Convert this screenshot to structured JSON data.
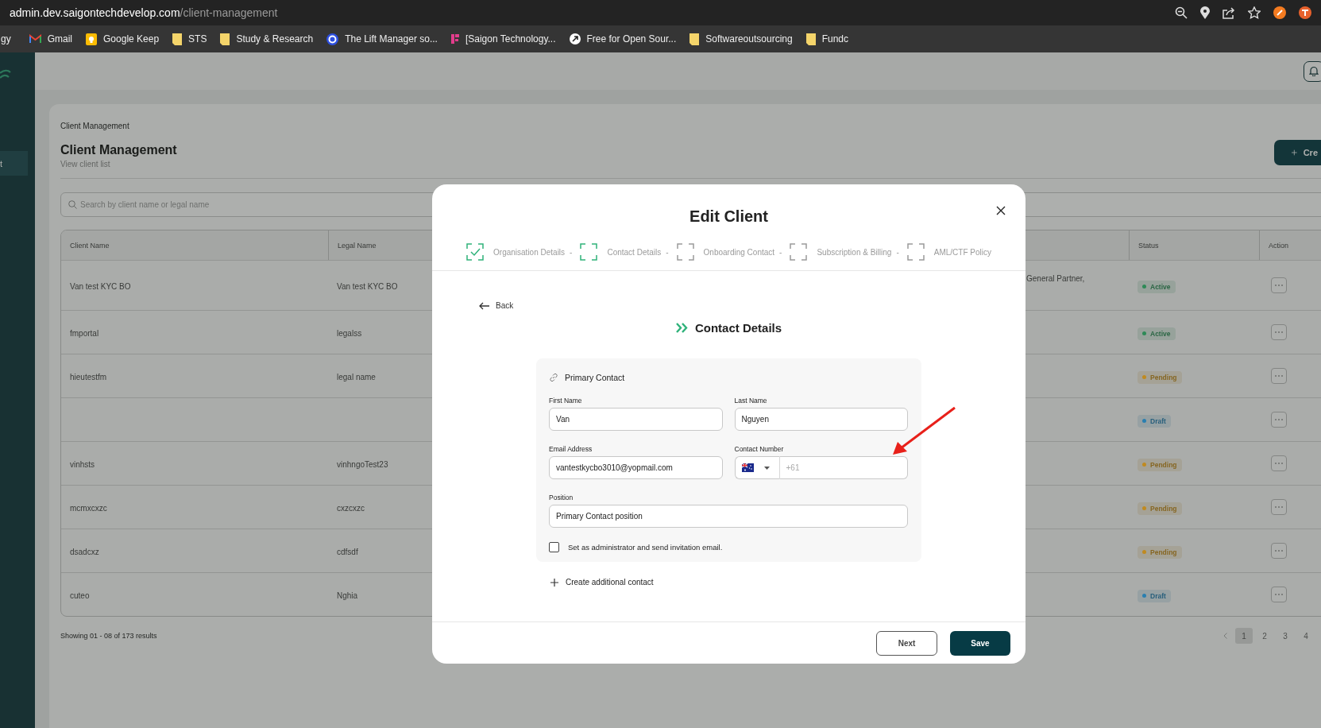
{
  "browser": {
    "url_host": "admin.dev.saigontechdevelop.com",
    "url_path": "/client-management",
    "bookmarks": [
      {
        "label": "gy",
        "kind": "cut"
      },
      {
        "label": "Gmail",
        "kind": "mail"
      },
      {
        "label": "Google Keep",
        "kind": "note"
      },
      {
        "label": "STS",
        "kind": "page"
      },
      {
        "label": "Study & Research",
        "kind": "page"
      },
      {
        "label": "The Lift Manager so...",
        "kind": "ring"
      },
      {
        "label": "[Saigon Technology...",
        "kind": "blocks"
      },
      {
        "label": "Free for Open Sour...",
        "kind": "arrow"
      },
      {
        "label": "Softwareoutsourcing",
        "kind": "page"
      },
      {
        "label": "Fundc",
        "kind": "page"
      }
    ]
  },
  "sidebar": {
    "items": [
      {
        "label": "t",
        "selected": true
      }
    ]
  },
  "page": {
    "breadcrumb": "Client Management",
    "title": "Client Management",
    "subtitle": "View client list",
    "create_button": "Cre",
    "search": {
      "placeholder": "Search by client name or legal name"
    },
    "table": {
      "columns": [
        "Client Name",
        "Legal Name",
        "Status",
        "Action"
      ],
      "rows": [
        {
          "client_name": "Van test KYC BO",
          "legal_name": "Van test KYC BO",
          "column_3": "General Partner,",
          "status": {
            "label": "Active",
            "color": "#2e8a57"
          }
        },
        {
          "client_name": "fmportal",
          "legal_name": "legalss",
          "status": {
            "label": "Active",
            "color": "#2e8a57"
          }
        },
        {
          "client_name": "hieutestfm",
          "legal_name": "legal name",
          "status": {
            "label": "Pending",
            "color": "#c08a20"
          }
        },
        {
          "status": {
            "label": "Draft",
            "color": "#2a7fb0"
          }
        },
        {
          "client_name": "vinhsts",
          "legal_name": "vinhngoTest23",
          "status": {
            "label": "Pending",
            "color": "#c08a20"
          }
        },
        {
          "client_name": "mcmxcxzc",
          "legal_name": "cxzcxzc",
          "status": {
            "label": "Pending",
            "color": "#c08a20"
          }
        },
        {
          "client_name": "dsadcxz",
          "legal_name": "cdfsdf",
          "status": {
            "label": "Pending",
            "color": "#c08a20"
          }
        },
        {
          "client_name": "cuteo",
          "legal_name": "Nghia",
          "status": {
            "label": "Draft",
            "color": "#2a7fb0"
          }
        }
      ]
    },
    "results": "Showing 01 - 08 of 173 results",
    "pages": [
      {
        "label": "1",
        "selected": true
      },
      {
        "label": "2",
        "selected": false
      },
      {
        "label": "3",
        "selected": false
      },
      {
        "label": "4",
        "selected": false
      }
    ]
  },
  "modal": {
    "title": "Edit Client",
    "steps": [
      {
        "label": "Organisation Details",
        "done": true,
        "active": true,
        "separator": "-"
      },
      {
        "label": "Contact Details",
        "done": false,
        "active": true,
        "separator": "-"
      },
      {
        "label": "Onboarding Contact",
        "done": false,
        "active": false,
        "separator": "-"
      },
      {
        "label": "Subscription & Billing",
        "done": false,
        "active": false,
        "separator": "-"
      },
      {
        "label": "AML/CTF Policy",
        "done": false,
        "active": false
      }
    ],
    "back": "Back",
    "heading": "Contact Details",
    "card_title": "Primary Contact",
    "field_rows": [
      [
        {
          "label": "First Name",
          "kind": "text",
          "value": "Van"
        },
        {
          "label": "Last Name",
          "kind": "text",
          "value": "Nguyen"
        }
      ],
      [
        {
          "label": "Email Address",
          "kind": "text",
          "value": "vantestkycbo3010@yopmail.com"
        },
        {
          "label": "Contact Number",
          "kind": "phone",
          "placeholder": "+61"
        }
      ],
      [
        {
          "label": "Position",
          "kind": "text",
          "value": "Primary Contact position"
        }
      ]
    ],
    "admin_checkbox": {
      "label": "Set as administrator and send invitation email.",
      "checked": false
    },
    "add_contact": "Create additional contact",
    "next_button": "Next",
    "save_button": "Save"
  }
}
